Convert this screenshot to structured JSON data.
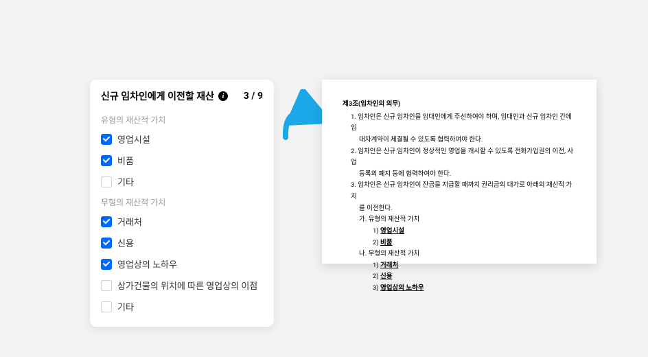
{
  "card": {
    "title": "신규 임차인에게 이전할 재산",
    "counter": "3 / 9",
    "sections": [
      {
        "label": "유형의 재산적 가치",
        "items": [
          {
            "label": "영업시설",
            "checked": true
          },
          {
            "label": "비품",
            "checked": true
          },
          {
            "label": "기타",
            "checked": false
          }
        ]
      },
      {
        "label": "무형의 재산적 가치",
        "items": [
          {
            "label": "거래처",
            "checked": true
          },
          {
            "label": "신용",
            "checked": true
          },
          {
            "label": "영업상의 노하우",
            "checked": true
          },
          {
            "label": "상가건물의 위치에 따른 영업상의 이점",
            "checked": false
          },
          {
            "label": "기타",
            "checked": false
          }
        ]
      }
    ]
  },
  "document": {
    "title": "제3조(임차인의 의무)",
    "lines": [
      {
        "type": "item",
        "text": "1. 임차인은 신규 임차인을 임대인에게 주선하여야 하며, 임대인과 신규 임차인 간에 임"
      },
      {
        "type": "item-cont",
        "text": "대차계약이 체결될 수 있도록 협력하여야 한다."
      },
      {
        "type": "item",
        "text": "2. 임차인은 신규 임차인이 정상적인 영업을 개시할 수 있도록 전화가입권의 이전, 사업"
      },
      {
        "type": "item-cont",
        "text": "등록의 폐지 등에 협력하여야 한다."
      },
      {
        "type": "item",
        "text": "3. 임차인은 신규 임차인이 잔금을 지급할 때까지 권리금의 대가로 아래의 재산적 가치"
      },
      {
        "type": "item-cont",
        "text": "를 이전한다."
      },
      {
        "type": "sub",
        "text": "가. 유형의 재산적 가치"
      },
      {
        "type": "subsub",
        "prefix": "1) ",
        "bold": "영업시설"
      },
      {
        "type": "subsub",
        "prefix": "2) ",
        "bold": "비품"
      },
      {
        "type": "sub",
        "text": "나. 무형의 재산적 가치"
      },
      {
        "type": "subsub",
        "prefix": "1) ",
        "bold": "거래처"
      },
      {
        "type": "subsub",
        "prefix": "2) ",
        "bold": "신용"
      },
      {
        "type": "subsub",
        "prefix": "3) ",
        "bold": "영업상의 노하우"
      }
    ]
  }
}
